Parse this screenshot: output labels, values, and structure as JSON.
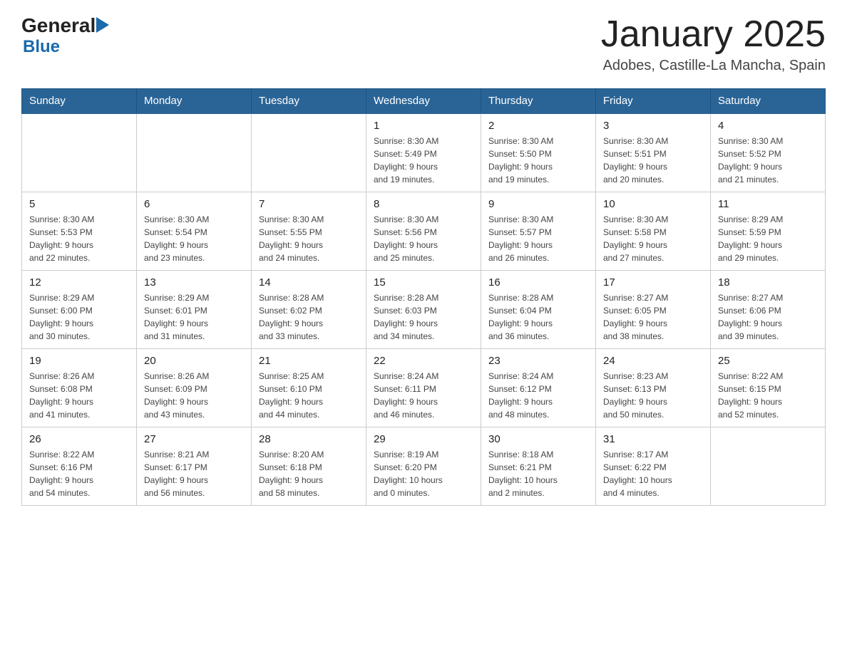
{
  "header": {
    "title": "January 2025",
    "subtitle": "Adobes, Castille-La Mancha, Spain",
    "logo": {
      "general": "General",
      "blue": "Blue"
    }
  },
  "calendar": {
    "days_of_week": [
      "Sunday",
      "Monday",
      "Tuesday",
      "Wednesday",
      "Thursday",
      "Friday",
      "Saturday"
    ],
    "weeks": [
      {
        "days": [
          {
            "number": "",
            "info": ""
          },
          {
            "number": "",
            "info": ""
          },
          {
            "number": "",
            "info": ""
          },
          {
            "number": "1",
            "info": "Sunrise: 8:30 AM\nSunset: 5:49 PM\nDaylight: 9 hours\nand 19 minutes."
          },
          {
            "number": "2",
            "info": "Sunrise: 8:30 AM\nSunset: 5:50 PM\nDaylight: 9 hours\nand 19 minutes."
          },
          {
            "number": "3",
            "info": "Sunrise: 8:30 AM\nSunset: 5:51 PM\nDaylight: 9 hours\nand 20 minutes."
          },
          {
            "number": "4",
            "info": "Sunrise: 8:30 AM\nSunset: 5:52 PM\nDaylight: 9 hours\nand 21 minutes."
          }
        ]
      },
      {
        "days": [
          {
            "number": "5",
            "info": "Sunrise: 8:30 AM\nSunset: 5:53 PM\nDaylight: 9 hours\nand 22 minutes."
          },
          {
            "number": "6",
            "info": "Sunrise: 8:30 AM\nSunset: 5:54 PM\nDaylight: 9 hours\nand 23 minutes."
          },
          {
            "number": "7",
            "info": "Sunrise: 8:30 AM\nSunset: 5:55 PM\nDaylight: 9 hours\nand 24 minutes."
          },
          {
            "number": "8",
            "info": "Sunrise: 8:30 AM\nSunset: 5:56 PM\nDaylight: 9 hours\nand 25 minutes."
          },
          {
            "number": "9",
            "info": "Sunrise: 8:30 AM\nSunset: 5:57 PM\nDaylight: 9 hours\nand 26 minutes."
          },
          {
            "number": "10",
            "info": "Sunrise: 8:30 AM\nSunset: 5:58 PM\nDaylight: 9 hours\nand 27 minutes."
          },
          {
            "number": "11",
            "info": "Sunrise: 8:29 AM\nSunset: 5:59 PM\nDaylight: 9 hours\nand 29 minutes."
          }
        ]
      },
      {
        "days": [
          {
            "number": "12",
            "info": "Sunrise: 8:29 AM\nSunset: 6:00 PM\nDaylight: 9 hours\nand 30 minutes."
          },
          {
            "number": "13",
            "info": "Sunrise: 8:29 AM\nSunset: 6:01 PM\nDaylight: 9 hours\nand 31 minutes."
          },
          {
            "number": "14",
            "info": "Sunrise: 8:28 AM\nSunset: 6:02 PM\nDaylight: 9 hours\nand 33 minutes."
          },
          {
            "number": "15",
            "info": "Sunrise: 8:28 AM\nSunset: 6:03 PM\nDaylight: 9 hours\nand 34 minutes."
          },
          {
            "number": "16",
            "info": "Sunrise: 8:28 AM\nSunset: 6:04 PM\nDaylight: 9 hours\nand 36 minutes."
          },
          {
            "number": "17",
            "info": "Sunrise: 8:27 AM\nSunset: 6:05 PM\nDaylight: 9 hours\nand 38 minutes."
          },
          {
            "number": "18",
            "info": "Sunrise: 8:27 AM\nSunset: 6:06 PM\nDaylight: 9 hours\nand 39 minutes."
          }
        ]
      },
      {
        "days": [
          {
            "number": "19",
            "info": "Sunrise: 8:26 AM\nSunset: 6:08 PM\nDaylight: 9 hours\nand 41 minutes."
          },
          {
            "number": "20",
            "info": "Sunrise: 8:26 AM\nSunset: 6:09 PM\nDaylight: 9 hours\nand 43 minutes."
          },
          {
            "number": "21",
            "info": "Sunrise: 8:25 AM\nSunset: 6:10 PM\nDaylight: 9 hours\nand 44 minutes."
          },
          {
            "number": "22",
            "info": "Sunrise: 8:24 AM\nSunset: 6:11 PM\nDaylight: 9 hours\nand 46 minutes."
          },
          {
            "number": "23",
            "info": "Sunrise: 8:24 AM\nSunset: 6:12 PM\nDaylight: 9 hours\nand 48 minutes."
          },
          {
            "number": "24",
            "info": "Sunrise: 8:23 AM\nSunset: 6:13 PM\nDaylight: 9 hours\nand 50 minutes."
          },
          {
            "number": "25",
            "info": "Sunrise: 8:22 AM\nSunset: 6:15 PM\nDaylight: 9 hours\nand 52 minutes."
          }
        ]
      },
      {
        "days": [
          {
            "number": "26",
            "info": "Sunrise: 8:22 AM\nSunset: 6:16 PM\nDaylight: 9 hours\nand 54 minutes."
          },
          {
            "number": "27",
            "info": "Sunrise: 8:21 AM\nSunset: 6:17 PM\nDaylight: 9 hours\nand 56 minutes."
          },
          {
            "number": "28",
            "info": "Sunrise: 8:20 AM\nSunset: 6:18 PM\nDaylight: 9 hours\nand 58 minutes."
          },
          {
            "number": "29",
            "info": "Sunrise: 8:19 AM\nSunset: 6:20 PM\nDaylight: 10 hours\nand 0 minutes."
          },
          {
            "number": "30",
            "info": "Sunrise: 8:18 AM\nSunset: 6:21 PM\nDaylight: 10 hours\nand 2 minutes."
          },
          {
            "number": "31",
            "info": "Sunrise: 8:17 AM\nSunset: 6:22 PM\nDaylight: 10 hours\nand 4 minutes."
          },
          {
            "number": "",
            "info": ""
          }
        ]
      }
    ]
  }
}
